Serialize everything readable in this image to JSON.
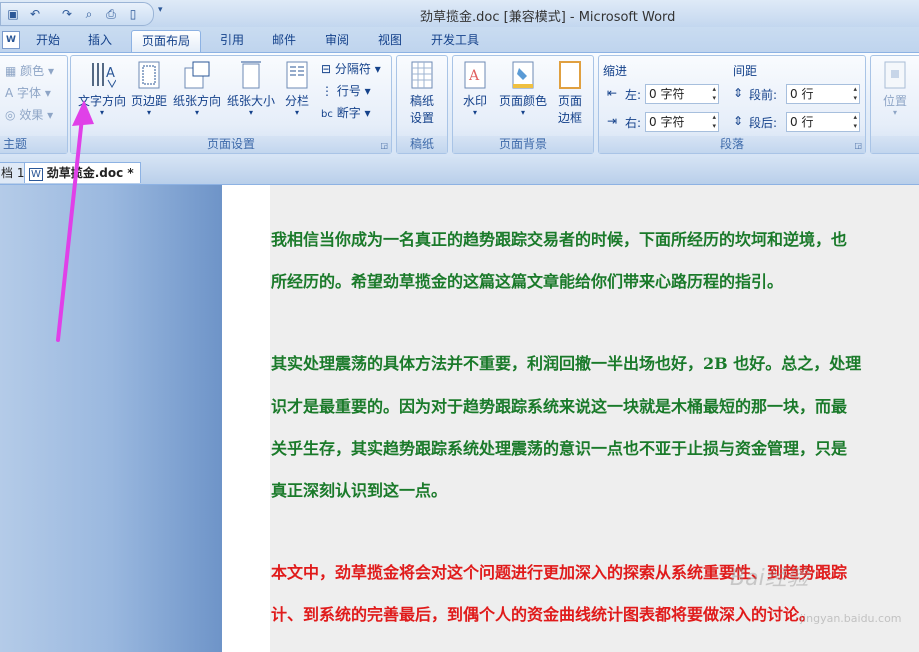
{
  "window": {
    "title": "劲草揽金.doc [兼容模式] - Microsoft Word"
  },
  "tabs": [
    {
      "label": "开始"
    },
    {
      "label": "插入"
    },
    {
      "label": "页面布局",
      "active": true
    },
    {
      "label": "引用"
    },
    {
      "label": "邮件"
    },
    {
      "label": "审阅"
    },
    {
      "label": "视图"
    },
    {
      "label": "开发工具"
    }
  ],
  "ribbon": {
    "themes": {
      "label": "主题",
      "colors": "颜色",
      "fonts": "字体",
      "effects": "效果"
    },
    "page_setup": {
      "label": "页面设置",
      "text_direction": "文字方向",
      "margins": "页边距",
      "orientation": "纸张方向",
      "size": "纸张大小",
      "columns": "分栏",
      "breaks": "分隔符",
      "line_numbers": "行号",
      "hyphenation": "断字"
    },
    "manuscript": {
      "label": "稿纸",
      "setup_line1": "稿纸",
      "setup_line2": "设置"
    },
    "page_background": {
      "label": "页面背景",
      "watermark": "水印",
      "page_color": "页面颜色",
      "page_borders_line1": "页面",
      "page_borders_line2": "边框"
    },
    "paragraph": {
      "label": "段落",
      "indent_title": "缩进",
      "spacing_title": "间距",
      "indent_left_label": "左:",
      "indent_left_value": "0 字符",
      "indent_right_label": "右:",
      "indent_right_value": "0 字符",
      "spacing_before_label": "段前:",
      "spacing_before_value": "0 行",
      "spacing_after_label": "段后:",
      "spacing_after_value": "0 行"
    },
    "arrange": {
      "position": "位置"
    }
  },
  "doc_tabs": [
    {
      "label": "档 1"
    },
    {
      "label": "劲草揽金.doc *"
    }
  ],
  "document": {
    "lines": [
      {
        "text": "我相信当你成为一名真正的趋势跟踪交易者的时候，下面所经历的坎坷和逆境，也",
        "color": "green"
      },
      {
        "text": "所经历的。希望劲草揽金的这篇这篇文章能给你们带来心路历程的指引。",
        "color": "green"
      },
      {
        "text": "其实处理震荡的具体方法并不重要，利润回撤一半出场也好，2B 也好。总之，处理",
        "color": "green"
      },
      {
        "text": "识才是最重要的。因为对于趋势跟踪系统来说这一块就是木桶最短的那一块，而最",
        "color": "green"
      },
      {
        "text": "关乎生存，其实趋势跟踪系统处理震荡的意识一点也不亚于止损与资金管理，只是",
        "color": "green"
      },
      {
        "text": "真正深刻认识到这一点。",
        "color": "green"
      },
      {
        "text": "本文中，劲草揽金将会对这个问题进行更加深入的探索从系统重要性、到趋势跟踪",
        "color": "red"
      },
      {
        "text": "计、到系统的完善最后，到偶个人的资金曲线统计图表都将要做深入的讨论。",
        "color": "red"
      }
    ]
  },
  "watermark": {
    "text": "Bai经验",
    "url": "jingyan.baidu.com"
  },
  "colors": {
    "accent": "#15428b",
    "annotation_arrow": "#e040e8",
    "green_text": "#1a7a2a",
    "red_text": "#e01b1b"
  }
}
